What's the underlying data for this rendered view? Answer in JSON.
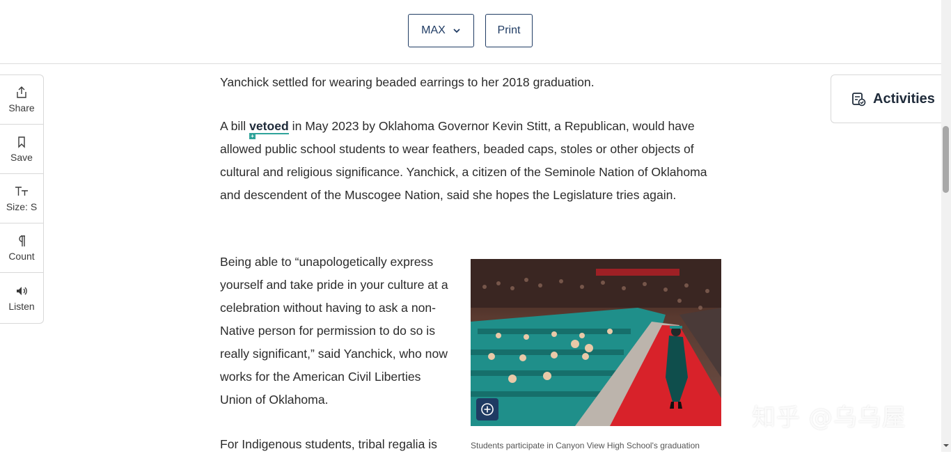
{
  "header": {
    "level_label": "MAX",
    "print_label": "Print"
  },
  "toolbar": {
    "items": [
      {
        "label": "Share",
        "icon": "share-icon"
      },
      {
        "label": "Save",
        "icon": "bookmark-icon"
      },
      {
        "label": "Size: S",
        "icon": "text-size-icon"
      },
      {
        "label": "Count",
        "icon": "paragraph-icon"
      },
      {
        "label": "Listen",
        "icon": "speaker-icon"
      }
    ]
  },
  "activities": {
    "label": "Activities",
    "icon": "clipboard-check-icon"
  },
  "article": {
    "p1": "Yanchick settled for wearing beaded earrings to her 2018 graduation.",
    "p2_before": "A bill ",
    "p2_vocab": "vetoed",
    "p2_after": " in May 2023 by Oklahoma Governor Kevin Stitt, a Republican, would have allowed public school students to wear feathers, beaded caps, stoles or other objects of cultural and religious significance. Yanchick, a citizen of the Seminole Nation of Oklahoma and descendent of the Muscogee Nation, said she hopes the Legislature tries again.",
    "p3": "Being able to “unapologetically express yourself and take pride in your culture at a celebration without having to ask a non-Native person for permission to do so is really significant,” said Yanchick, who now works for the American Civil Liberties Union of Oklahoma.",
    "p4": "For Indigenous students, tribal regalia is"
  },
  "image": {
    "caption": "Students participate in Canyon View High School's graduation"
  },
  "watermark": "知乎 @乌乌屋",
  "colors": {
    "navy": "#1f3b63",
    "teal_gown": "#1f8f8a",
    "carpet_red": "#d8222a",
    "vocab_teal": "#2fa39a"
  }
}
